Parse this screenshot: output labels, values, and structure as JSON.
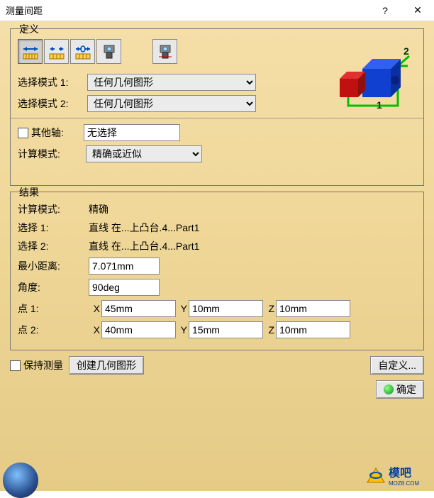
{
  "window": {
    "title": "测量间距",
    "help": "?",
    "close": "✕"
  },
  "definition": {
    "legend": "定义",
    "mode1_label": "选择模式 1:",
    "mode2_label": "选择模式 2:",
    "mode1_value": "任何几何图形",
    "mode2_value": "任何几何图形",
    "other_axis_label": "其他轴:",
    "other_axis_value": "无选择",
    "calc_mode_label": "计算模式:",
    "calc_mode_value": "精确或近似"
  },
  "results": {
    "legend": "结果",
    "calc_mode_label": "计算模式:",
    "calc_mode_value": "精确",
    "sel1_label": "选择 1:",
    "sel1_value": "直线 在...上凸台.4...Part1",
    "sel2_label": "选择 2:",
    "sel2_value": "直线 在...上凸台.4...Part1",
    "min_dist_label": "最小距离:",
    "min_dist_value": "7.071mm",
    "angle_label": "角度:",
    "angle_value": "90deg",
    "point1_label": "点 1:",
    "point2_label": "点 2:",
    "xl": "X",
    "yl": "Y",
    "zl": "Z",
    "p1x": "45mm",
    "p1y": "10mm",
    "p1z": "10mm",
    "p2x": "40mm",
    "p2y": "15mm",
    "p2z": "10mm"
  },
  "footer": {
    "keep_measure": "保持测量",
    "create_geo": "创建几何图形",
    "customize": "自定义...",
    "ok": "确定"
  },
  "icons": {
    "arrow_mode": "two-way-arrow-icon",
    "ruler_arrow": "ruler-two-way-icon",
    "ruler_wide": "ruler-wide-icon",
    "caliper": "caliper-icon",
    "caliper2": "caliper2-icon",
    "preview_label1": "1",
    "preview_label2": "2"
  },
  "watermark": {
    "text": "模吧",
    "sub": "MOZ8.COM"
  }
}
